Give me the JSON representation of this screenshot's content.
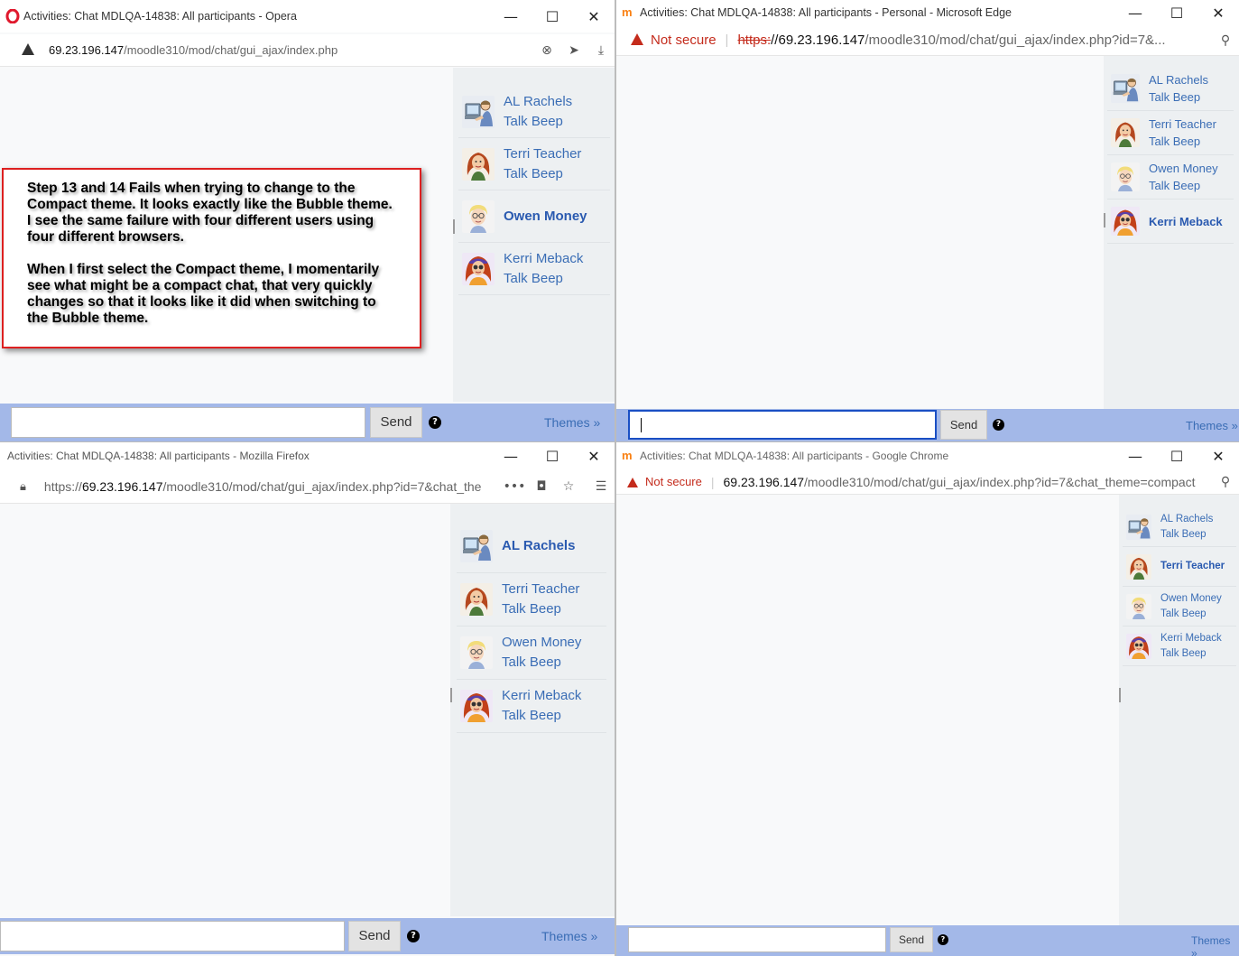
{
  "colors": {
    "link": "#3a6db5",
    "bar": "#a3b8e8",
    "warning_red": "#c42b1c",
    "note_border": "#dd2020"
  },
  "opera": {
    "title": "Activities: Chat MDLQA-14838: All participants - Opera",
    "url_host": "69.23.196.147",
    "url_path": "/moodle310/mod/chat/gui_ajax/index.php",
    "users": [
      {
        "name": "AL Rachels",
        "beep": "Talk Beep",
        "avatar": "computer-user"
      },
      {
        "name": "Terri Teacher",
        "beep": "Talk Beep",
        "avatar": "red-hair-teacher"
      },
      {
        "name": "Owen Money",
        "beep": "",
        "avatar": "blonde-glasses"
      },
      {
        "name": "Kerri Meback",
        "beep": "Talk Beep",
        "avatar": "red-hair-glasses"
      }
    ],
    "send": "Send",
    "themes": "Themes »"
  },
  "edge": {
    "title": "Activities: Chat MDLQA-14838: All participants - Personal - Microsoft Edge",
    "not_secure": "Not secure",
    "url_scheme": "https:",
    "url_host": "//69.23.196.147",
    "url_path": "/moodle310/mod/chat/gui_ajax/index.php?id=7&...",
    "users": [
      {
        "name": "AL Rachels",
        "beep": "Talk Beep",
        "avatar": "computer-user"
      },
      {
        "name": "Terri Teacher",
        "beep": "Talk Beep",
        "avatar": "red-hair-teacher"
      },
      {
        "name": "Owen Money",
        "beep": "Talk Beep",
        "avatar": "blonde-glasses"
      },
      {
        "name": "Kerri Meback",
        "beep": "",
        "avatar": "red-hair-glasses"
      }
    ],
    "send": "Send",
    "themes": "Themes »"
  },
  "firefox": {
    "title": "Activities: Chat MDLQA-14838: All participants - Mozilla Firefox",
    "url_scheme": "https://",
    "url_host": "69.23.196.147",
    "url_path": "/moodle310/mod/chat/gui_ajax/index.php?id=7&chat_the",
    "users": [
      {
        "name": "AL Rachels",
        "beep": "",
        "avatar": "computer-user"
      },
      {
        "name": "Terri Teacher",
        "beep": "Talk Beep",
        "avatar": "red-hair-teacher"
      },
      {
        "name": "Owen Money",
        "beep": "Talk Beep",
        "avatar": "blonde-glasses"
      },
      {
        "name": "Kerri Meback",
        "beep": "Talk Beep",
        "avatar": "red-hair-glasses"
      }
    ],
    "send": "Send",
    "themes": "Themes »"
  },
  "chrome": {
    "title": "Activities: Chat MDLQA-14838: All participants - Google Chrome",
    "not_secure": "Not secure",
    "url_host": "69.23.196.147",
    "url_path": "/moodle310/mod/chat/gui_ajax/index.php?id=7&chat_theme=compact",
    "users": [
      {
        "name": "AL Rachels",
        "beep": "Talk Beep",
        "avatar": "computer-user"
      },
      {
        "name": "Terri Teacher",
        "beep": "",
        "avatar": "red-hair-teacher"
      },
      {
        "name": "Owen Money",
        "beep": "Talk Beep",
        "avatar": "blonde-glasses"
      },
      {
        "name": "Kerri Meback",
        "beep": "Talk Beep",
        "avatar": "red-hair-glasses"
      }
    ],
    "send": "Send",
    "themes": "Themes »"
  },
  "note": {
    "paragraph1_lines": [
      "Step 13 and 14 Fails when trying to change to the",
      "Compact theme. It looks exactly like the Bubble theme.",
      "I see the same failure with four different users using",
      "four different browsers."
    ],
    "paragraph2_lines": [
      "When I first select the Compact theme, I momentarily",
      "see what might be a compact chat, that very quickly",
      "changes so that it looks like it did when switching to",
      "the Bubble theme."
    ]
  }
}
